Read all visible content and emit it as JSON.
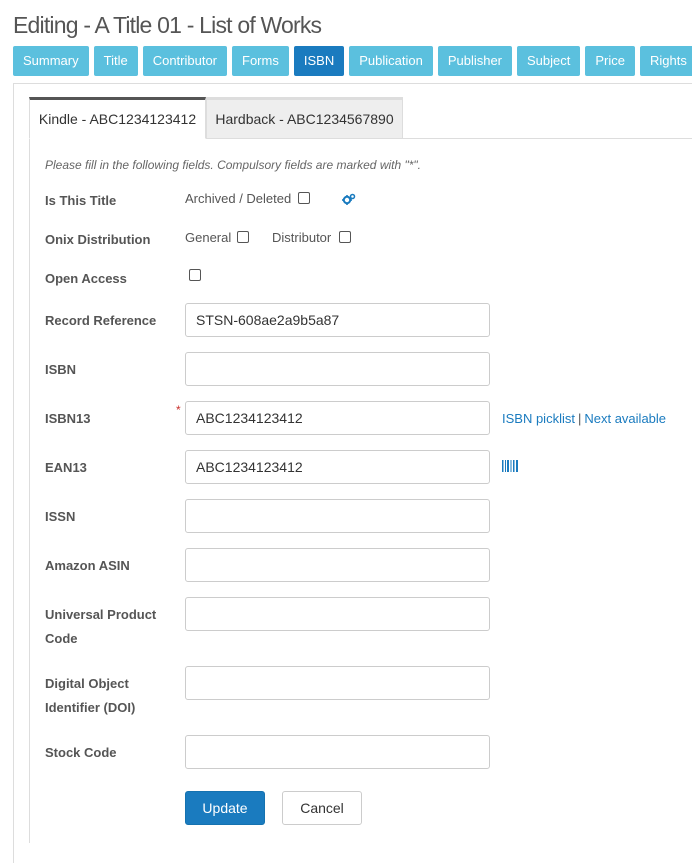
{
  "page": {
    "title": "Editing - A Title 01 - List of Works"
  },
  "nav": [
    {
      "label": "Summary",
      "active": false
    },
    {
      "label": "Title",
      "active": false
    },
    {
      "label": "Contributor",
      "active": false
    },
    {
      "label": "Forms",
      "active": false
    },
    {
      "label": "ISBN",
      "active": true
    },
    {
      "label": "Publication",
      "active": false
    },
    {
      "label": "Publisher",
      "active": false
    },
    {
      "label": "Subject",
      "active": false
    },
    {
      "label": "Price",
      "active": false
    },
    {
      "label": "Rights",
      "active": false
    }
  ],
  "tabs": [
    {
      "label": "Kindle - ABC1234123412",
      "active": true
    },
    {
      "label": "Hardback - ABC1234567890",
      "active": false
    }
  ],
  "form": {
    "instructions": "Please fill in the following fields. Compulsory fields are marked with \"*\".",
    "is_this_title": {
      "label": "Is This Title",
      "option": "Archived / Deleted"
    },
    "onix_distribution": {
      "label": "Onix Distribution",
      "option_general": "General",
      "option_distributor": "Distributor"
    },
    "open_access": {
      "label": "Open Access"
    },
    "record_reference": {
      "label": "Record Reference",
      "value": "STSN-608ae2a9b5a87"
    },
    "isbn": {
      "label": "ISBN",
      "value": ""
    },
    "isbn13": {
      "label": "ISBN13",
      "value": "ABC1234123412",
      "required_mark": "*"
    },
    "isbn_links": {
      "picklist": "ISBN picklist",
      "separator": "|",
      "next": "Next available"
    },
    "ean13": {
      "label": "EAN13",
      "value": "ABC1234123412"
    },
    "issn": {
      "label": "ISSN",
      "value": ""
    },
    "amazon_asin": {
      "label": "Amazon ASIN",
      "value": ""
    },
    "upc": {
      "label_line1": "Universal Product",
      "label_line2": "Code",
      "value": ""
    },
    "doi": {
      "label_line1": "Digital Object",
      "label_line2": "Identifier (DOI)",
      "value": ""
    },
    "stock_code": {
      "label": "Stock Code",
      "value": ""
    }
  },
  "buttons": {
    "update": "Update",
    "cancel": "Cancel"
  },
  "colors": {
    "nav_bg": "#5bc0de",
    "nav_active": "#1a7bbf",
    "link": "#1a7bbf",
    "required": "#c9302c"
  }
}
